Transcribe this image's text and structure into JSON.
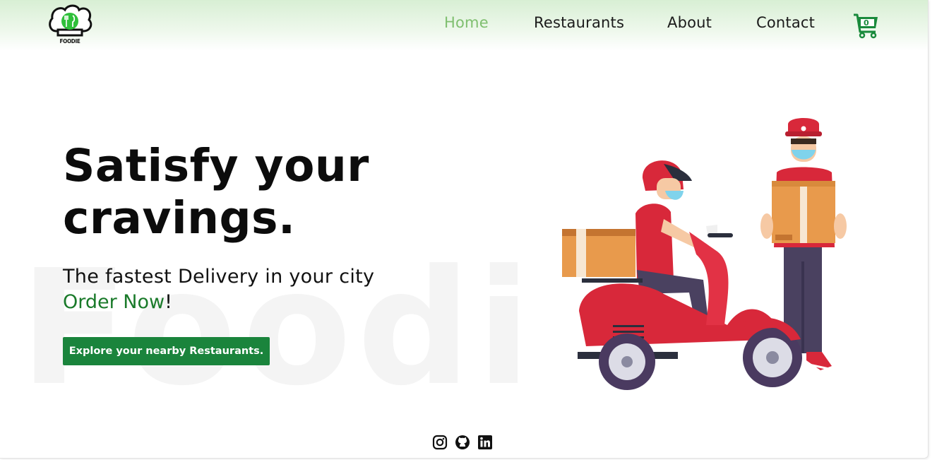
{
  "brand": {
    "logo_text": "FOODIE"
  },
  "nav": {
    "items": [
      {
        "label": "Home",
        "active": true
      },
      {
        "label": "Restaurants",
        "active": false
      },
      {
        "label": "About",
        "active": false
      },
      {
        "label": "Contact",
        "active": false
      }
    ],
    "cart_count": "0"
  },
  "hero": {
    "title": "Satisfy your cravings.",
    "subtitle": "The fastest Delivery in your city",
    "order_highlight": "Order Now",
    "order_suffix": "!",
    "watermark": "Foodie",
    "cta_label": "Explore your nearby Restaurants."
  },
  "footer": {
    "social_icons": [
      "instagram-icon",
      "github-icon",
      "linkedin-icon"
    ]
  },
  "colors": {
    "accent": "#1a843c",
    "nav_active": "#7fbf6f",
    "delivery_red": "#d8283a",
    "box_orange": "#e89a4c"
  }
}
